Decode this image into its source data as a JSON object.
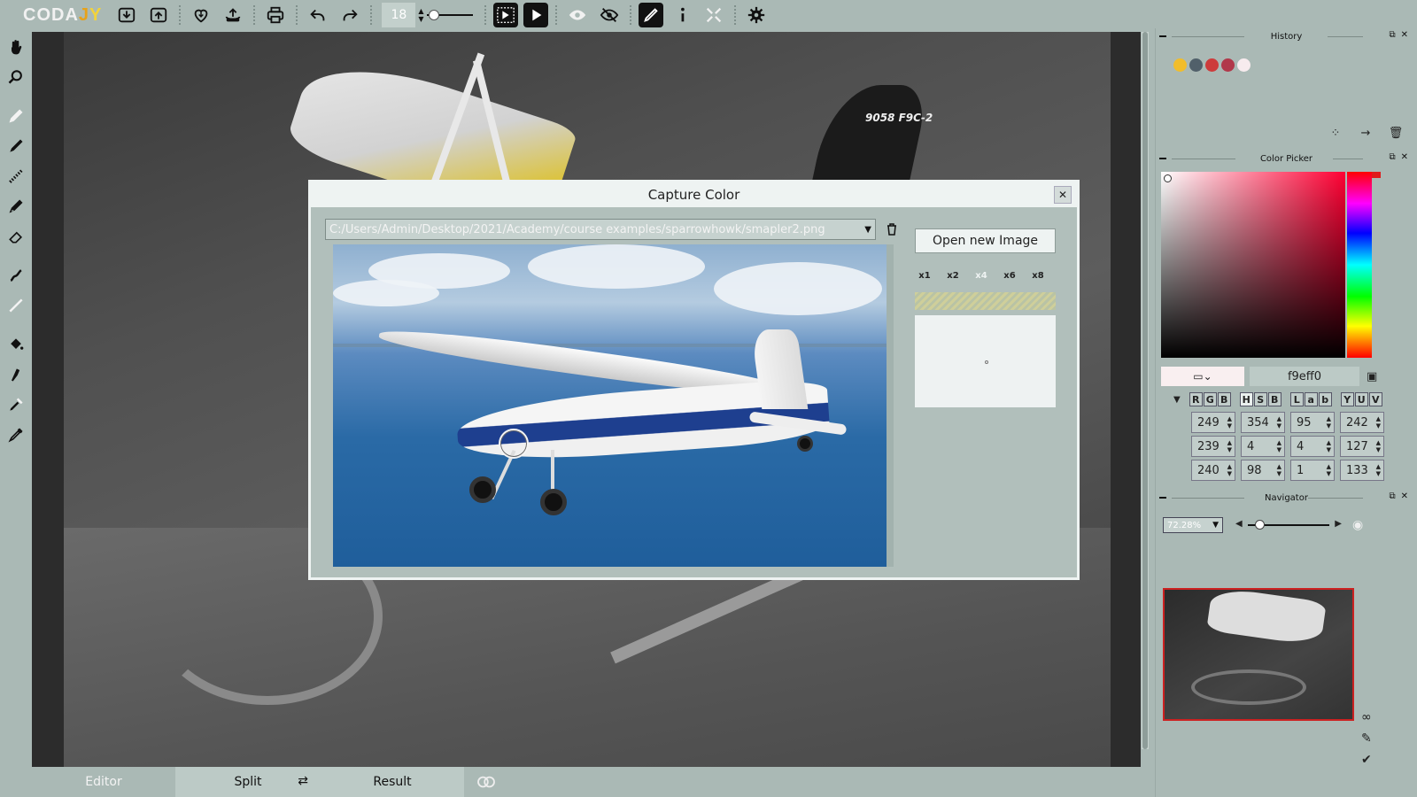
{
  "app": {
    "logo_main": "CODA",
    "logo_j": "J",
    "logo_y": "Y"
  },
  "toolbar": {
    "brush_size": "18",
    "icons": [
      "import-icon",
      "export-icon",
      "save-heart-icon",
      "upload-icon",
      "print-icon",
      "undo-icon",
      "redo-icon",
      "play-step-icon",
      "play-icon",
      "eye-icon",
      "eye-crossed-icon",
      "pen-active-icon",
      "info-icon",
      "fullscreen-icon",
      "settings-gear-icon"
    ]
  },
  "left_tools": [
    "move-hand-icon",
    "zoom-icon",
    "pencil-icon",
    "brush-icon",
    "dotted-brush-icon",
    "fine-pen-icon",
    "eraser-icon",
    "smudge-icon",
    "line-icon",
    "fill-bucket-icon",
    "stamp-icon",
    "picker-drop-icon",
    "eyedropper-icon"
  ],
  "canvas": {
    "tail_text": "9058  F9C-2"
  },
  "bottom_tabs": {
    "editor": "Editor",
    "split": "Split",
    "result": "Result"
  },
  "history": {
    "title": "History",
    "swatches": [
      "#f1bd2b",
      "#51606a",
      "#cd3b3b",
      "#b1384a",
      "#f7ebee"
    ]
  },
  "color_picker": {
    "title": "Color Picker",
    "hex": "f9eff0",
    "preview_color": "#f9eff0",
    "models": {
      "rgb": [
        "R",
        "G",
        "B"
      ],
      "hsb": [
        "H",
        "S",
        "B"
      ],
      "lab": [
        "L",
        "a",
        "b"
      ],
      "yuv": [
        "Y",
        "U",
        "V"
      ]
    },
    "values": [
      [
        "249",
        "354",
        "95",
        "242"
      ],
      [
        "239",
        "4",
        "4",
        "127"
      ],
      [
        "240",
        "98",
        "1",
        "133"
      ]
    ]
  },
  "navigator": {
    "title": "Navigator",
    "zoom": "72.28%"
  },
  "dialog": {
    "title": "Capture Color",
    "path": "C:/Users/Admin/Desktop/2021/Academy/course examples/sparrowhowk/smapler2.png",
    "open_button": "Open new Image",
    "zoom_options": [
      "x1",
      "x2",
      "x4",
      "x6",
      "x8"
    ],
    "selected_zoom": "x4"
  }
}
